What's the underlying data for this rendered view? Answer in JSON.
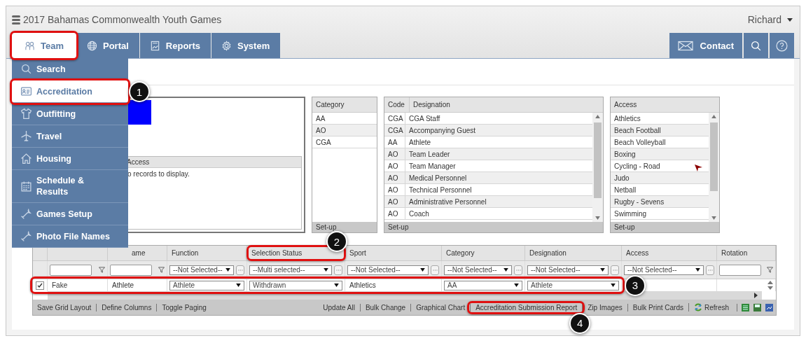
{
  "app_title": "2017 Bahamas Commonwealth Youth Games",
  "user": "Richard",
  "tabs": [
    {
      "label": "Team",
      "selected": true
    },
    {
      "label": "Portal",
      "selected": false
    },
    {
      "label": "Reports",
      "selected": false
    },
    {
      "label": "System",
      "selected": false
    }
  ],
  "contact": "Contact",
  "menu": [
    {
      "label": "Search",
      "selected": false
    },
    {
      "label": "Accreditation",
      "selected": true
    },
    {
      "label": "Outfitting",
      "selected": false
    },
    {
      "label": "Travel",
      "selected": false
    },
    {
      "label": "Housing",
      "selected": false
    },
    {
      "label": "Schedule & Results",
      "selected": false
    },
    {
      "label": "Games Setup",
      "selected": false
    },
    {
      "label": "Photo File Names",
      "selected": false
    }
  ],
  "details_panel": {
    "subgrid_column": "Access",
    "empty_message": "o records to display."
  },
  "category_panel": {
    "column": "Category",
    "rows": [
      "AA",
      "AO",
      "CGA"
    ],
    "footer": "Set-up"
  },
  "designation_panel": {
    "columns": [
      "Code",
      "Designation"
    ],
    "rows": [
      [
        "CGA",
        "CGA Staff"
      ],
      [
        "CGA",
        "Accompanying Guest"
      ],
      [
        "AA",
        "Athlete"
      ],
      [
        "AO",
        "Team Leader"
      ],
      [
        "AO",
        "Team Manager"
      ],
      [
        "AO",
        "Medical Personnel"
      ],
      [
        "AO",
        "Technical Personnel"
      ],
      [
        "AO",
        "Administrative Personnel"
      ],
      [
        "AO",
        "Coach"
      ]
    ],
    "footer": "Set-up"
  },
  "access_panel": {
    "column": "Access",
    "rows": [
      "Athletics",
      "Beach Football",
      "Beach Volleyball",
      "Boxing",
      "Cycling - Road",
      "Judo",
      "Netball",
      "Rugby - Sevens",
      "Swimming"
    ],
    "footer": "Set-up"
  },
  "grid": {
    "columns": [
      {
        "kind": "check"
      },
      {
        "filter": {
          "kind": "text"
        }
      },
      {
        "label": "ame",
        "filter": {
          "kind": "text"
        }
      },
      {
        "label": "Function",
        "filter": {
          "kind": "select",
          "value": "--Not Selected--"
        }
      },
      {
        "label": "Selection Status",
        "filter": {
          "kind": "select",
          "value": "--Multi selected--"
        }
      },
      {
        "label": "Sport",
        "filter": {
          "kind": "select",
          "value": "--Not Selected--"
        }
      },
      {
        "label": "Category",
        "filter": {
          "kind": "select",
          "value": "--Not Selected--"
        }
      },
      {
        "label": "Designation",
        "filter": {
          "kind": "select",
          "value": "--Not Selected--"
        }
      },
      {
        "label": "Access",
        "filter": {
          "kind": "select",
          "value": "--Not Selected--"
        }
      },
      {
        "label": "Rotation",
        "filter": {
          "kind": "text"
        }
      }
    ],
    "row": {
      "checked": true,
      "cells": [
        {
          "kind": "text",
          "value": "Fake"
        },
        {
          "kind": "text",
          "value": "Athlete"
        },
        {
          "kind": "select",
          "value": "Athlete"
        },
        {
          "kind": "select",
          "value": "Withdrawn"
        },
        {
          "kind": "text",
          "value": "Athletics"
        },
        {
          "kind": "select",
          "value": "AA"
        },
        {
          "kind": "select",
          "value": "Athlete"
        },
        {
          "kind": "empty"
        },
        {
          "kind": "empty"
        }
      ]
    },
    "footer_left": [
      "Save Grid Layout",
      "Define Columns",
      "Toggle Paging"
    ],
    "footer_right": [
      "Update All",
      "Bulk Change",
      "Graphical Chart",
      "Accreditation Submission Report",
      "Zip Images",
      "Bulk Print Cards"
    ],
    "refresh": "Refresh"
  },
  "callouts": [
    {
      "number": "1"
    },
    {
      "number": "2"
    },
    {
      "number": "3"
    },
    {
      "number": "4"
    }
  ]
}
